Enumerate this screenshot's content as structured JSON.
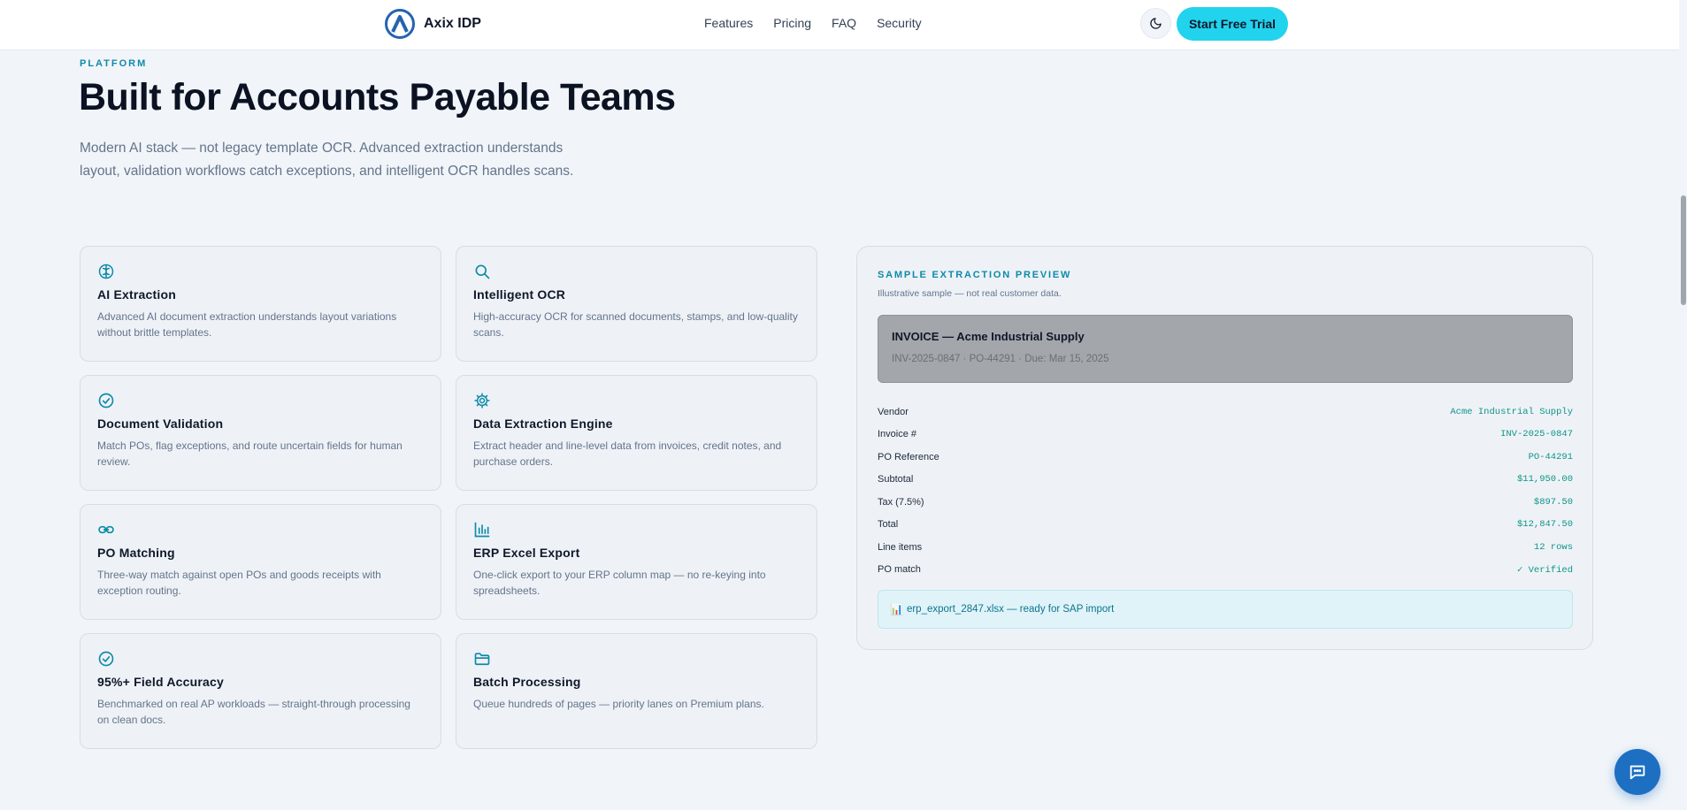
{
  "header": {
    "brand": "Axix IDP",
    "nav": [
      "Features",
      "Pricing",
      "FAQ",
      "Security"
    ],
    "cta_label": "Start Free Trial"
  },
  "hero": {
    "eyebrow": "PLATFORM",
    "title": "Built for Accounts Payable Teams",
    "description": "Modern AI stack — not legacy template OCR. Advanced extraction understands layout, validation workflows catch exceptions, and intelligent OCR handles scans."
  },
  "features": [
    {
      "icon": "brain-icon",
      "title": "AI Extraction",
      "description": "Advanced AI document extraction understands layout variations without brittle templates."
    },
    {
      "icon": "search-icon",
      "title": "Intelligent OCR",
      "description": "High-accuracy OCR for scanned documents, stamps, and low-quality scans."
    },
    {
      "icon": "check-circle-icon",
      "title": "Document Validation",
      "description": "Match POs, flag exceptions, and route uncertain fields for human review."
    },
    {
      "icon": "gear-icon",
      "title": "Data Extraction Engine",
      "description": "Extract header and line-level data from invoices, credit notes, and purchase orders."
    },
    {
      "icon": "link-icon",
      "title": "PO Matching",
      "description": "Three-way match against open POs and goods receipts with exception routing."
    },
    {
      "icon": "bar-chart-icon",
      "title": "ERP Excel Export",
      "description": "One-click export to your ERP column map — no re-keying into spreadsheets."
    },
    {
      "icon": "check-circle-icon",
      "title": "95%+ Field Accuracy",
      "description": "Benchmarked on real AP workloads — straight-through processing on clean docs."
    },
    {
      "icon": "folder-icon",
      "title": "Batch Processing",
      "description": "Queue hundreds of pages — priority lanes on Premium plans."
    }
  ],
  "preview": {
    "label": "SAMPLE EXTRACTION PREVIEW",
    "note": "Illustrative sample — not real customer data.",
    "invoice_title": "INVOICE — Acme Industrial Supply",
    "invoice_meta": "INV-2025-0847 · PO-44291 · Due: Mar 15, 2025",
    "fields": [
      {
        "label": "Vendor",
        "value": "Acme Industrial Supply"
      },
      {
        "label": "Invoice #",
        "value": "INV-2025-0847"
      },
      {
        "label": "PO Reference",
        "value": "PO-44291"
      },
      {
        "label": "Subtotal",
        "value": "$11,950.00"
      },
      {
        "label": "Tax (7.5%)",
        "value": "$897.50"
      },
      {
        "label": "Total",
        "value": "$12,847.50"
      },
      {
        "label": "Line items",
        "value": "12 rows"
      },
      {
        "label": "PO match",
        "value": "✓ Verified"
      }
    ],
    "export_icon": "📊",
    "export_text": "erp_export_2847.xlsx — ready for SAP import"
  },
  "colors": {
    "accent": "#0e8aa8",
    "cta": "#22d3ee",
    "value_green": "#0f9488",
    "chat_blue": "#1d6fc2"
  }
}
